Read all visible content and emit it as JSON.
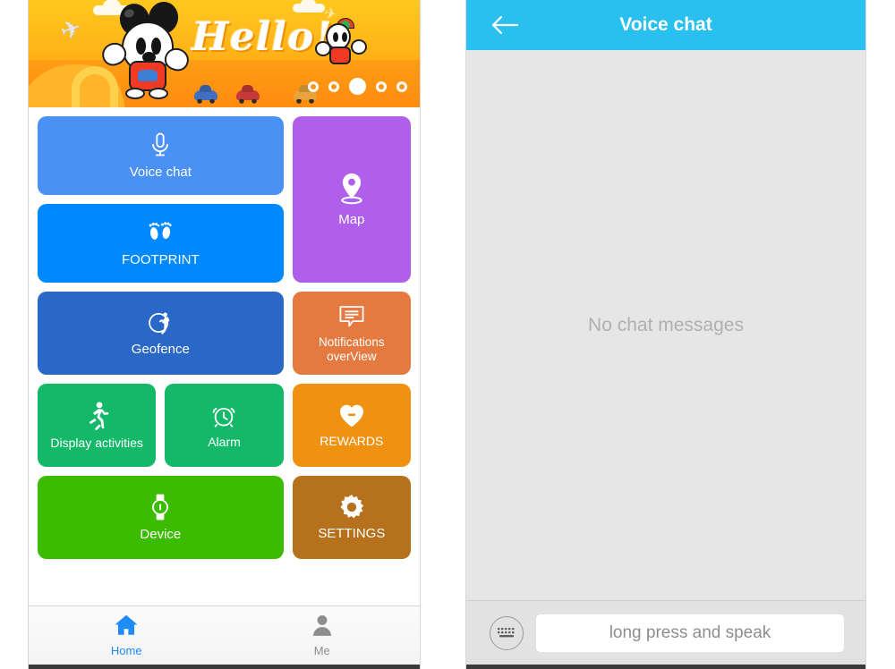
{
  "left_screen": {
    "banner": {
      "greeting": "Hello!",
      "page_dots": {
        "count": 5,
        "active_index": 2
      }
    },
    "tiles": [
      {
        "id": "voice-chat",
        "label": "Voice chat",
        "icon": "microphone-icon",
        "color": "#4a90f5"
      },
      {
        "id": "map",
        "label": "Map",
        "icon": "location-pin-icon",
        "color": "#b05fea"
      },
      {
        "id": "footprint",
        "label": "FOOTPRINT",
        "icon": "footprints-icon",
        "color": "#0089ff"
      },
      {
        "id": "geofence",
        "label": "Geofence",
        "icon": "geofence-icon",
        "color": "#2a68c8"
      },
      {
        "id": "notifications",
        "label": "Notifications overView",
        "icon": "message-icon",
        "color": "#e47a3f"
      },
      {
        "id": "display-activities",
        "label": "Display activities",
        "icon": "runner-icon",
        "color": "#13b869"
      },
      {
        "id": "alarm",
        "label": "Alarm",
        "icon": "alarm-clock-icon",
        "color": "#13b869"
      },
      {
        "id": "rewards",
        "label": "REWARDS",
        "icon": "heart-icon",
        "color": "#ef9212"
      },
      {
        "id": "device",
        "label": "Device",
        "icon": "watch-icon",
        "color": "#3cbc00"
      },
      {
        "id": "settings",
        "label": "SETTINGS",
        "icon": "gear-icon",
        "color": "#b5711c"
      }
    ],
    "tabbar": {
      "active_color": "#1f8cf5",
      "inactive_color": "#8d8d8d",
      "tabs": [
        {
          "id": "home",
          "label": "Home",
          "icon": "home-icon",
          "active": true
        },
        {
          "id": "me",
          "label": "Me",
          "icon": "person-icon",
          "active": false
        }
      ]
    }
  },
  "right_screen": {
    "navbar": {
      "back_icon": "arrow-left-icon",
      "title": "Voice chat",
      "background": "#29c0f0"
    },
    "chat": {
      "empty_state": "No chat messages"
    },
    "composer": {
      "keyboard_icon": "keyboard-icon",
      "speak_label": "long press and speak",
      "speak_placeholder": "long press and speak"
    }
  }
}
